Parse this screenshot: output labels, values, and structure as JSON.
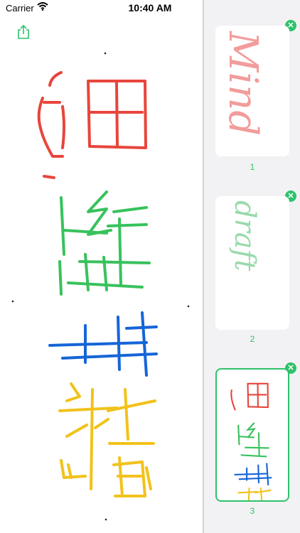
{
  "status": {
    "carrier": "Carrier",
    "time": "10:40 AM"
  },
  "thumbnails": [
    {
      "label": "1",
      "text": "Mind"
    },
    {
      "label": "2",
      "text": "draft"
    },
    {
      "label": "3"
    }
  ],
  "colors": {
    "accent": "#2ec26b",
    "red": "#e8453c",
    "green": "#38c25c",
    "blue": "#1565d8",
    "yellow": "#f2c21b"
  },
  "icons": {
    "share": "share-icon",
    "close": "close-icon"
  }
}
